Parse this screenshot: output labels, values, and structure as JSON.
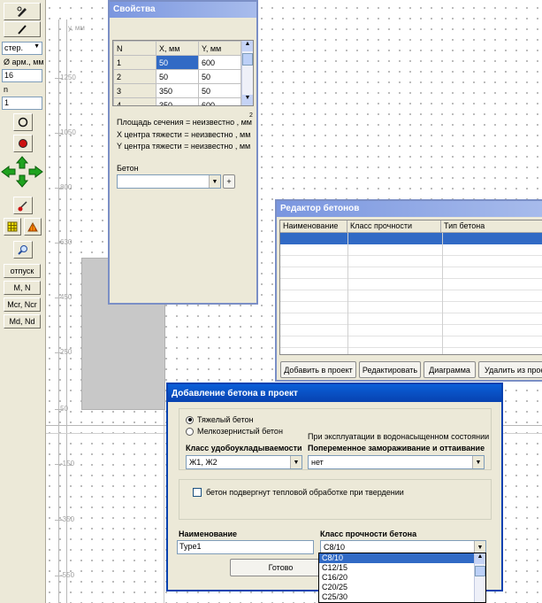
{
  "toolbar": {
    "rebar_mode": "стер.",
    "diameter_label": "Ø арм., мм",
    "diameter_value": "16",
    "n_label": "n",
    "n_value": "1",
    "release_button": "отпуск",
    "mn_button": "M, N",
    "mcr_button": "Mcr, Ncr",
    "mdnd_button": "Md, Nd",
    "colors": {
      "arrow": "#1fa31f",
      "background": "#ece9d8"
    }
  },
  "canvas": {
    "axis_label": "y, мм",
    "y_ticks": [
      "1250",
      "1050",
      "800",
      "630",
      "450",
      "250",
      "50",
      "-150",
      "-350",
      "-550"
    ]
  },
  "properties_window": {
    "title": "Свойства",
    "columns": [
      "N",
      "X, мм",
      "Y, мм"
    ],
    "rows": [
      {
        "n": "1",
        "x": "50",
        "y": "600"
      },
      {
        "n": "2",
        "x": "50",
        "y": "50"
      },
      {
        "n": "3",
        "x": "350",
        "y": "50"
      },
      {
        "n": "4",
        "x": "350",
        "y": "600"
      }
    ],
    "area": "Площадь сечения = неизвестно , мм",
    "area_sup": "2",
    "x_center": "X центра тяжести = неизвестно , мм",
    "y_center": "Y центра тяжести = неизвестно , мм",
    "concrete_label": "Бетон",
    "concrete_value": "",
    "add_button": "+"
  },
  "editor_window": {
    "title": "Редактор бетонов",
    "columns": [
      "Наименование",
      "Класс прочности",
      "Тип бетона"
    ],
    "buttons": [
      "Добавить в проект",
      "Редактировать",
      "Диаграмма",
      "Удалить из прое"
    ]
  },
  "add_dialog": {
    "title": "Добавление бетона в проект",
    "radio_heavy": "Тяжелый бетон",
    "radio_fine": "Мелкозернистый бетон",
    "workability_label": "Класс удобоукладываемости",
    "workability_value": "Ж1, Ж2",
    "saturated_label": "При эксплуатации в водонасыщенном состоянии",
    "freeze_label": "Попеременное замораживание и оттаивание",
    "freeze_value": "нет",
    "heat_checkbox": "бетон подвергнут тепловой обработке при твердении",
    "name_label": "Наименование",
    "name_value": "Type1",
    "strength_label": "Класс прочности бетона",
    "strength_value": "C8/10",
    "ok_button": "Готово",
    "strength_options": [
      "C8/10",
      "C12/15",
      "C16/20",
      "C20/25",
      "C25/30"
    ]
  }
}
